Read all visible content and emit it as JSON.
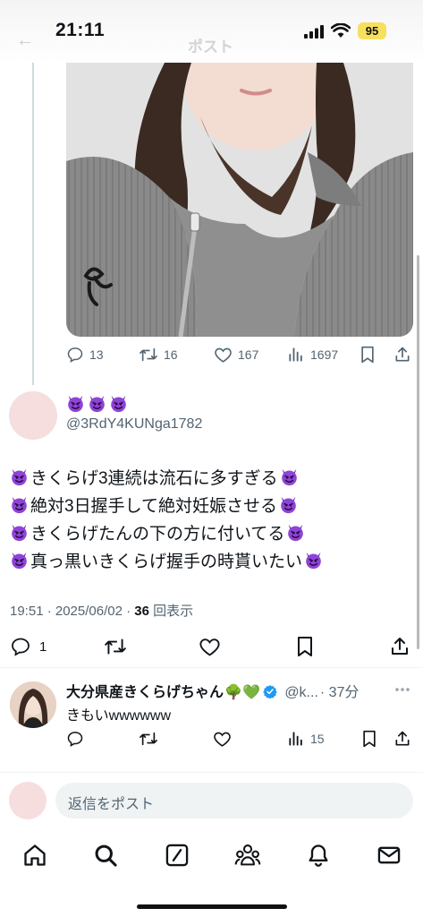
{
  "status_bar": {
    "time": "21:11",
    "battery": "95"
  },
  "header": {
    "back_glyph": "←",
    "title": "ポスト"
  },
  "parent_tweet": {
    "replies": "13",
    "reposts": "16",
    "likes": "167",
    "views": "1697"
  },
  "reply_tweet": {
    "display_name_emoji": "😈😈😈",
    "handle": "@3RdY4KUNga1782",
    "lines": [
      "きくらげ3連続は流石に多すぎる",
      "絶対3日握手して絶対妊娠させる",
      "きくらげたんの下の方に付いてる",
      "真っ黒いきくらげ握手の時貰いたい"
    ],
    "time_date": "19:51 · 2025/06/02 · ",
    "view_count": "36",
    "view_label": "回表示",
    "replies": "1"
  },
  "nested_reply": {
    "name": "大分県産きくらげちゃん",
    "name_emoji": "🌳💚",
    "handle": "@k...",
    "time": "· 37分",
    "text": "きもいwwwwww",
    "views": "15"
  },
  "composer": {
    "placeholder": "返信をポスト"
  },
  "colors": {
    "accent": "#1d9bf0",
    "muted": "#536471",
    "devil": "#8b3fd1"
  },
  "icons": [
    "reply-icon",
    "repost-icon",
    "like-icon",
    "views-icon",
    "bookmark-icon",
    "share-icon",
    "home-icon",
    "search-icon",
    "grok-icon",
    "communities-icon",
    "notifications-icon",
    "messages-icon",
    "verified-icon",
    "more-icon"
  ]
}
